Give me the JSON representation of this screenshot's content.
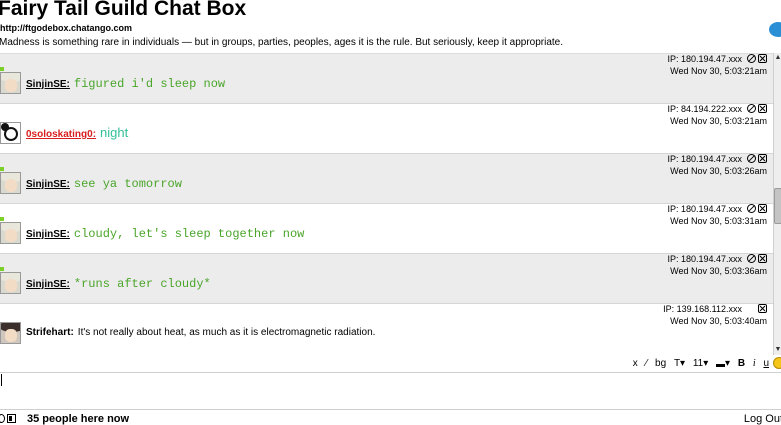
{
  "header": {
    "title": "Fairy Tail Guild Chat Box",
    "url": "http://ftgodebox.chatango.com",
    "description": "Madness is something rare in individuals — but in groups, parties, peoples, ages it is the rule. But seriously, keep it appropriate."
  },
  "messages": [
    {
      "name": "SinjinSE:",
      "text": "figured i'd sleep now",
      "ip": "IP: 180.194.47.xxx",
      "time": "Wed Nov 30, 5:03:21am"
    },
    {
      "name": "0soloskating0:",
      "text": "night",
      "ip": "IP: 84.194.222.xxx",
      "time": "Wed Nov 30, 5:03:21am"
    },
    {
      "name": "SinjinSE:",
      "text": "see ya tomorrow",
      "ip": "IP: 180.194.47.xxx",
      "time": "Wed Nov 30, 5:03:26am"
    },
    {
      "name": "SinjinSE:",
      "text": "cloudy, let's sleep together now",
      "ip": "IP: 180.194.47.xxx",
      "time": "Wed Nov 30, 5:03:31am"
    },
    {
      "name": "SinjinSE:",
      "text": "*runs after cloudy*",
      "ip": "IP: 180.194.47.xxx",
      "time": "Wed Nov 30, 5:03:36am"
    },
    {
      "name": "Strifehart:",
      "text": "It's not really about heat, as much as it is electromagnetic radiation.",
      "ip": "IP: 139.168.112.xxx",
      "time": "Wed Nov 30, 5:03:40am"
    }
  ],
  "toolbar": {
    "close": "x",
    "bg": "bg",
    "text_style": "T▾",
    "font_size": "11▾",
    "color": "▾",
    "bold": "B",
    "italic": "i",
    "underline": "u"
  },
  "input": {
    "value": ""
  },
  "footer": {
    "people": "35 people here now",
    "logout": "Log Out"
  },
  "colors": {
    "accent_green": "#4aa52a",
    "name_red": "#d81e1e",
    "teal_text": "#33c09a",
    "row_grey": "#ececec"
  }
}
